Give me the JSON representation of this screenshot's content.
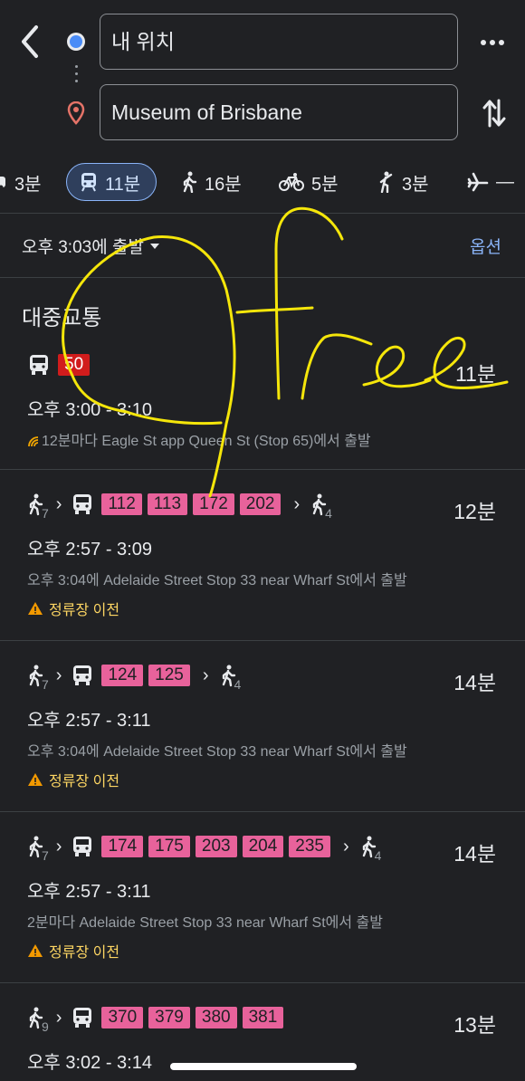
{
  "header": {
    "origin": "내 위치",
    "destination": "Museum of Brisbane"
  },
  "modes": [
    {
      "icon": "car-icon",
      "label": "3분"
    },
    {
      "icon": "transit-icon",
      "label": "11분",
      "active": true
    },
    {
      "icon": "walk-icon",
      "label": "16분"
    },
    {
      "icon": "bike-icon",
      "label": "5분"
    },
    {
      "icon": "ride-hail-icon",
      "label": "3분"
    },
    {
      "icon": "flight-icon",
      "label": "—"
    }
  ],
  "depart": {
    "label": "오후 3:03에 출발",
    "options": "옵션"
  },
  "section_title": "대중교통",
  "routes": [
    {
      "chips": [
        "50"
      ],
      "duration": "11분",
      "times": "오후 3:00 - 3:10",
      "detail": "12분마다 Eagle St app Queen St (Stop 65)에서 출발"
    },
    {
      "walk_before": "7",
      "chips": [
        "112",
        "113",
        "172",
        "202"
      ],
      "walk_after": "4",
      "duration": "12분",
      "times": "오후 2:57 - 3:09",
      "detail": "오후 3:04에 Adelaide Street Stop 33 near Wharf St에서 출발",
      "warning": "정류장 이전"
    },
    {
      "walk_before": "7",
      "chips": [
        "124",
        "125"
      ],
      "walk_after": "4",
      "duration": "14분",
      "times": "오후 2:57 - 3:11",
      "detail": "오후 3:04에 Adelaide Street Stop 33 near Wharf St에서 출발",
      "warning": "정류장 이전"
    },
    {
      "walk_before": "7",
      "chips": [
        "174",
        "175",
        "203",
        "204",
        "235"
      ],
      "walk_after": "4",
      "duration": "14분",
      "times": "오후 2:57 - 3:11",
      "detail": "2분마다 Adelaide Street Stop 33 near Wharf St에서 출발",
      "warning": "정류장 이전"
    },
    {
      "walk_before": "9",
      "chips": [
        "370",
        "379",
        "380",
        "381"
      ],
      "duration": "13분",
      "times": "오후 3:02 - 3:14"
    }
  ],
  "colors": {
    "background": "#202124",
    "accent": "#8ab4f8",
    "chip": "#e8629b",
    "chip_red": "#d11c1c",
    "warning": "#fdd663",
    "annotation": "#f5e60a"
  }
}
